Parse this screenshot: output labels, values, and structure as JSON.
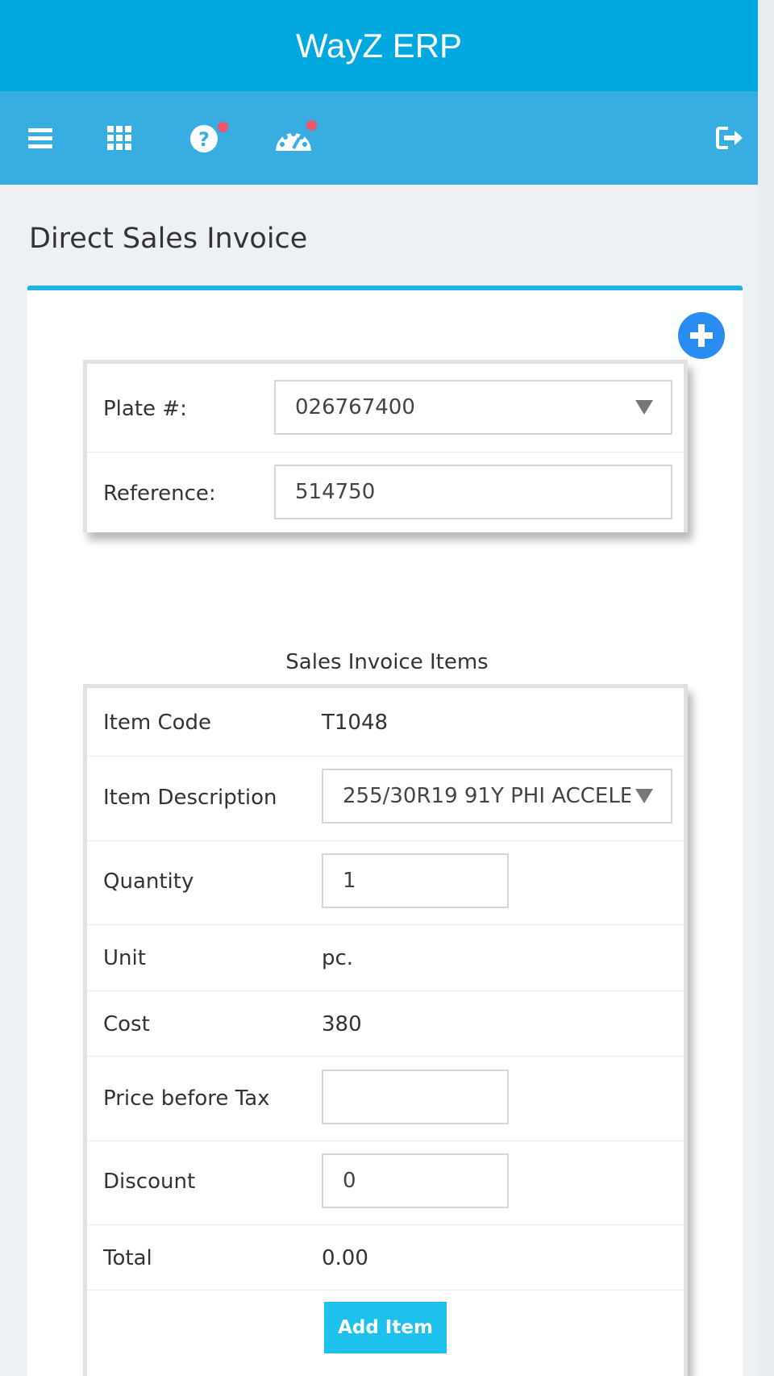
{
  "app": {
    "title": "WayZ ERP"
  },
  "toolbar": {
    "icons": [
      "menu-icon",
      "apps-grid-icon",
      "help-icon",
      "dashboard-icon",
      "logout-icon"
    ],
    "notification_color": "#f0556a"
  },
  "page": {
    "title": "Direct Sales Invoice"
  },
  "header_form": {
    "plate_label": "Plate #:",
    "plate_value": "026767400",
    "reference_label": "Reference:",
    "reference_value": "514750"
  },
  "items_section": {
    "title": "Sales Invoice Items",
    "item_code_label": "Item Code",
    "item_code_value": "T1048",
    "item_description_label": "Item Description",
    "item_description_value": "255/30R19 91Y PHI ACCELE",
    "quantity_label": "Quantity",
    "quantity_value": "1",
    "unit_label": "Unit",
    "unit_value": "pc.",
    "cost_label": "Cost",
    "cost_value": "380",
    "price_label": "Price before Tax",
    "price_value": "",
    "discount_label": "Discount",
    "discount_value": "0",
    "total_label": "Total",
    "total_value": "0.00",
    "add_button": "Add Item"
  },
  "colors": {
    "header": "#00a8e0",
    "toolbar": "#37ade2",
    "accent_border": "#1eb4e8",
    "add_button": "#1ec0ec",
    "add_circle": "#2a8cf0"
  }
}
